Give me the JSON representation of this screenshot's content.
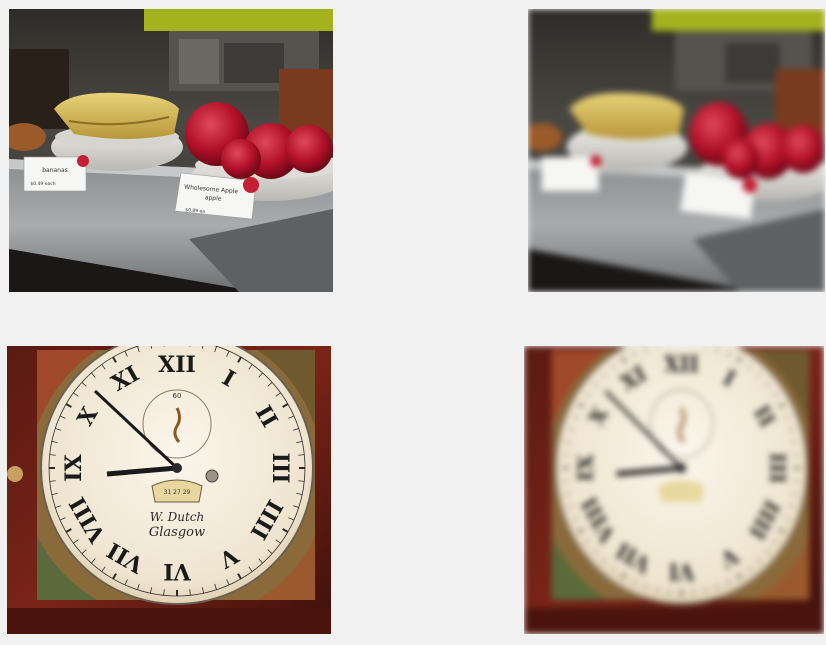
{
  "panels": [
    {
      "id": "fruit-sharp",
      "scene": "fruit-display",
      "blurred": false
    },
    {
      "id": "fruit-blur",
      "scene": "fruit-display",
      "blurred": true
    },
    {
      "id": "clock-sharp",
      "scene": "clock-face",
      "blurred": false
    },
    {
      "id": "clock-blur",
      "scene": "clock-face",
      "blurred": true
    }
  ],
  "fruit": {
    "banana_card": "bananas",
    "banana_price": "$0.49 each",
    "apple_card_line1": "Wholesome Apple",
    "apple_card_line2": "apple",
    "apple_price": "$0.89 ea"
  },
  "clock": {
    "numerals": [
      "XII",
      "I",
      "II",
      "III",
      "IIII",
      "V",
      "VI",
      "VII",
      "VIII",
      "IX",
      "X",
      "XI"
    ],
    "maker_line1": "W. Dutch",
    "maker_line2": "Glasgow",
    "date_plate": "31 27 29",
    "subdial_top": "60"
  }
}
